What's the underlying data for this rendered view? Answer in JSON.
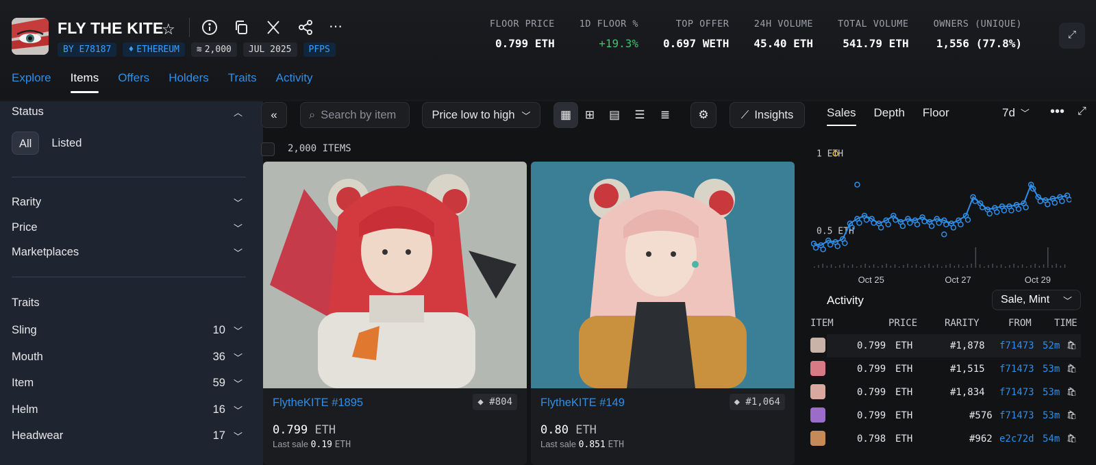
{
  "header": {
    "title": "FLY THE KITE",
    "chips": {
      "creator": "BY E78187",
      "chain": "ETHEREUM",
      "supply": "2,000",
      "date": "JUL 2025",
      "category": "PFPS"
    },
    "stats": [
      {
        "label": "FLOOR PRICE",
        "value": "0.799 ETH"
      },
      {
        "label": "1D FLOOR %",
        "value": "+19.3%"
      },
      {
        "label": "TOP OFFER",
        "value": "0.697 WETH"
      },
      {
        "label": "24H VOLUME",
        "value": "45.40 ETH"
      },
      {
        "label": "TOTAL VOLUME",
        "value": "541.79 ETH"
      },
      {
        "label": "OWNERS (UNIQUE)",
        "value": "1,556 (77.8%)"
      }
    ],
    "colors": {
      "positive": "#3cc46e",
      "link": "#2f8fe8"
    }
  },
  "tabs": [
    "Explore",
    "Items",
    "Offers",
    "Holders",
    "Traits",
    "Activity"
  ],
  "sidebar": {
    "status_label": "Status",
    "status_options": [
      "All",
      "Listed"
    ],
    "filters": [
      "Rarity",
      "Price",
      "Marketplaces"
    ],
    "traits_label": "Traits",
    "traits": [
      {
        "name": "Sling",
        "count": "10"
      },
      {
        "name": "Mouth",
        "count": "36"
      },
      {
        "name": "Item",
        "count": "59"
      },
      {
        "name": "Helm",
        "count": "16"
      },
      {
        "name": "Headwear",
        "count": "17"
      }
    ]
  },
  "toolbar": {
    "search_placeholder": "Search by item",
    "sort": "Price low to high",
    "insights": "Insights"
  },
  "items_count": "2,000 ITEMS",
  "cards": [
    {
      "name": "FlytheKITE #1895",
      "rank": "#804",
      "price": "0.799",
      "unit": "ETH",
      "last_label": "Last sale",
      "last_value": "0.19",
      "last_unit": "ETH"
    },
    {
      "name": "FlytheKITE #149",
      "rank": "#1,064",
      "price": "0.80",
      "unit": "ETH",
      "last_label": "Last sale",
      "last_value": "0.851",
      "last_unit": "ETH"
    }
  ],
  "chart_panel": {
    "tabs": [
      "Sales",
      "Depth",
      "Floor"
    ],
    "range": "7d",
    "y_labels": [
      "1 ETH",
      "0.5 ETH"
    ],
    "x_labels": [
      "Oct 25",
      "Oct 27",
      "Oct 29"
    ]
  },
  "chart_data": {
    "type": "scatter",
    "xlabel": "",
    "ylabel": "",
    "x_ticks": [
      "Oct 25",
      "Oct 27",
      "Oct 29"
    ],
    "y_ticks": [
      "1 ETH",
      "0.5 ETH"
    ],
    "series": [
      {
        "name": "",
        "values": [
          [
            0,
            0.42
          ],
          [
            1,
            0.41
          ],
          [
            2,
            0.44
          ],
          [
            3,
            0.43
          ],
          [
            4,
            0.45
          ],
          [
            5,
            0.55
          ],
          [
            6,
            0.58
          ],
          [
            7,
            0.6
          ],
          [
            8,
            0.58
          ],
          [
            9,
            0.55
          ],
          [
            10,
            0.57
          ],
          [
            11,
            0.6
          ],
          [
            12,
            0.56
          ],
          [
            13,
            0.58
          ],
          [
            14,
            0.57
          ],
          [
            15,
            0.59
          ],
          [
            16,
            0.56
          ],
          [
            17,
            0.58
          ],
          [
            18,
            0.57
          ],
          [
            19,
            0.55
          ],
          [
            20,
            0.57
          ],
          [
            21,
            0.6
          ],
          [
            22,
            0.72
          ],
          [
            23,
            0.68
          ],
          [
            24,
            0.64
          ],
          [
            25,
            0.65
          ],
          [
            26,
            0.66
          ],
          [
            27,
            0.66
          ],
          [
            28,
            0.67
          ],
          [
            29,
            0.68
          ],
          [
            30,
            0.8
          ],
          [
            31,
            0.72
          ],
          [
            32,
            0.7
          ],
          [
            33,
            0.71
          ],
          [
            34,
            0.72
          ],
          [
            35,
            0.73
          ]
        ]
      }
    ],
    "outliers": [
      [
        3,
        1.0
      ],
      [
        6,
        0.8
      ],
      [
        18,
        0.48
      ]
    ]
  },
  "activity": {
    "title": "Activity",
    "filter": "Sale, Mint",
    "columns": [
      "ITEM",
      "PRICE",
      "RARITY",
      "FROM",
      "TIME"
    ],
    "rows": [
      {
        "price": "0.799",
        "unit": "ETH",
        "rarity": "#1,878",
        "from": "f71473",
        "time": "52m",
        "thumb": "#c9b3a8"
      },
      {
        "price": "0.799",
        "unit": "ETH",
        "rarity": "#1,515",
        "from": "f71473",
        "time": "53m",
        "thumb": "#d77a86"
      },
      {
        "price": "0.799",
        "unit": "ETH",
        "rarity": "#1,834",
        "from": "f71473",
        "time": "53m",
        "thumb": "#d9a9a0"
      },
      {
        "price": "0.799",
        "unit": "ETH",
        "rarity": "#576",
        "from": "f71473",
        "time": "53m",
        "thumb": "#9b6dc9"
      },
      {
        "price": "0.798",
        "unit": "ETH",
        "rarity": "#962",
        "from": "e2c72d",
        "time": "54m",
        "thumb": "#c48a5a"
      }
    ]
  }
}
